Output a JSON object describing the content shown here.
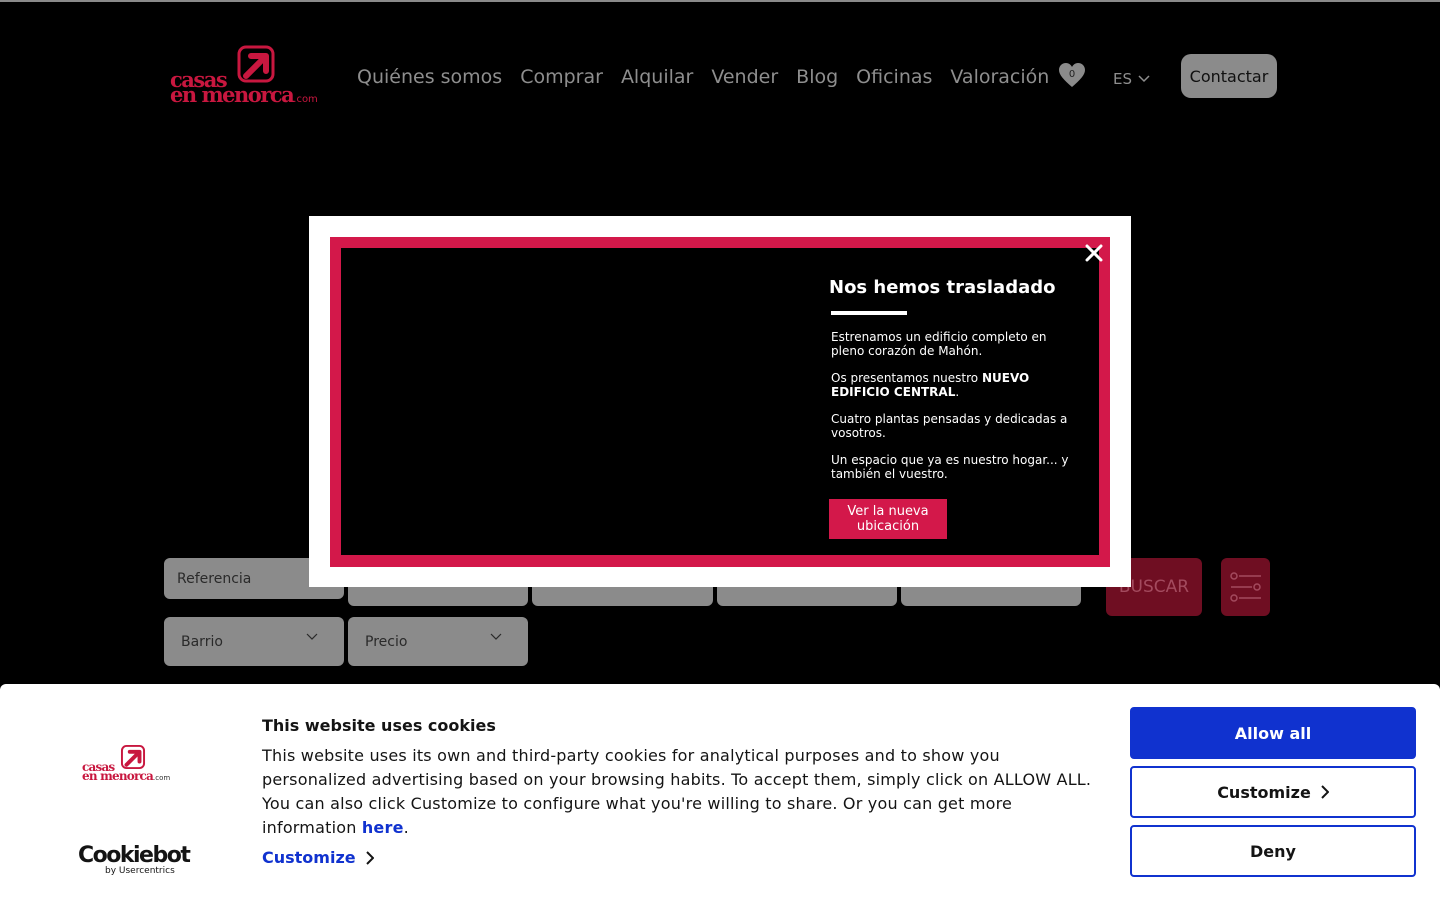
{
  "header": {
    "logo": {
      "line1": "casas",
      "line2": "en menorca",
      "suffix": ".com"
    },
    "nav": [
      "Quiénes somos",
      "Comprar",
      "Alquilar",
      "Vender",
      "Blog",
      "Oficinas",
      "Valoración"
    ],
    "favorites_count": "0",
    "language": "ES",
    "contact_label": "Contactar"
  },
  "search": {
    "reference_placeholder": "Referencia",
    "barrio_label": "Barrio",
    "precio_label": "Precio",
    "search_label": "BUSCAR"
  },
  "modal": {
    "title": "Nos hemos trasladado",
    "p1": "Estrenamos un edificio completo en pleno corazón de Mahón.",
    "p2_prefix": "Os presentamos nuestro ",
    "p2_bold": "NUEVO EDIFICIO CENTRAL",
    "p2_suffix": ".",
    "p3": "Cuatro plantas pensadas y dedicadas a vosotros.",
    "p4": "Un espacio que ya es nuestro hogar... y también el vuestro.",
    "cta_label": "Ver la nueva ubicación"
  },
  "cookie_banner": {
    "title": "This website uses cookies",
    "text": "This website uses its own and third-party cookies for analytical purposes and to show you personalized advertising based on your browsing habits. To accept them, simply click on ALLOW ALL. You can also click Customize to configure what you're willing to share. Or you can get more information ",
    "link_label": "here",
    "text_end": ".",
    "customize_link_label": "Customize",
    "allow_all_label": "Allow all",
    "customize_button_label": "Customize",
    "deny_label": "Deny",
    "provider_name": "Cookiebot",
    "provider_sub": "by Usercentrics",
    "logo": {
      "line1": "casas",
      "line2": "en menorca",
      "suffix": ".com"
    }
  },
  "colors": {
    "brand_red": "#d3184a",
    "cookie_blue": "#1032cf"
  }
}
